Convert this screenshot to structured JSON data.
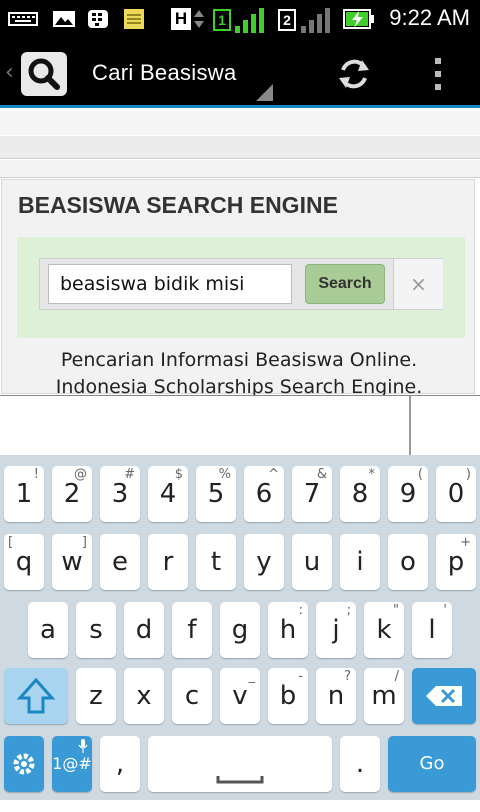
{
  "status_bar": {
    "time": "9:22 AM",
    "sim1": "1",
    "sim2": "2",
    "network_letter": "H"
  },
  "action_bar": {
    "title": "Cari Beasiswa"
  },
  "page": {
    "heading": "BEASISWA SEARCH ENGINE",
    "search_value": "beasiswa bidik misi",
    "search_button": "Search",
    "clear_symbol": "×",
    "tagline_1": "Pencarian Informasi Beasiswa Online.",
    "tagline_2": "Indonesia Scholarships Search Engine."
  },
  "keyboard": {
    "row1": [
      {
        "k": "1",
        "s": "!"
      },
      {
        "k": "2",
        "s": "@"
      },
      {
        "k": "3",
        "s": "#"
      },
      {
        "k": "4",
        "s": "$"
      },
      {
        "k": "5",
        "s": "%"
      },
      {
        "k": "6",
        "s": "^"
      },
      {
        "k": "7",
        "s": "&"
      },
      {
        "k": "8",
        "s": "*"
      },
      {
        "k": "9",
        "s": "("
      },
      {
        "k": "0",
        "s": ")"
      }
    ],
    "row2": [
      {
        "k": "q",
        "s": "["
      },
      {
        "k": "w",
        "s": "]"
      },
      {
        "k": "e",
        "s": ""
      },
      {
        "k": "r",
        "s": ""
      },
      {
        "k": "t",
        "s": ""
      },
      {
        "k": "y",
        "s": ""
      },
      {
        "k": "u",
        "s": ""
      },
      {
        "k": "i",
        "s": ""
      },
      {
        "k": "o",
        "s": ""
      },
      {
        "k": "p",
        "s": "+"
      }
    ],
    "row3": [
      {
        "k": "a",
        "s": ""
      },
      {
        "k": "s",
        "s": ""
      },
      {
        "k": "d",
        "s": ""
      },
      {
        "k": "f",
        "s": ""
      },
      {
        "k": "g",
        "s": ""
      },
      {
        "k": "h",
        "s": ":"
      },
      {
        "k": "j",
        "s": ";"
      },
      {
        "k": "k",
        "s": "\""
      },
      {
        "k": "l",
        "s": "'"
      }
    ],
    "row4": [
      {
        "k": "z",
        "s": ""
      },
      {
        "k": "x",
        "s": ""
      },
      {
        "k": "c",
        "s": ""
      },
      {
        "k": "v",
        "s": "_"
      },
      {
        "k": "b",
        "s": "-"
      },
      {
        "k": "n",
        "s": "?"
      },
      {
        "k": "m",
        "s": "/"
      }
    ],
    "symbols_label": "1@#",
    "comma": ",",
    "period": ".",
    "go_label": "Go"
  },
  "icons": {
    "back": "chevron-left-icon",
    "search": "search-icon",
    "refresh": "refresh-icon",
    "overflow": "overflow-menu-icon",
    "shift": "shift-icon",
    "backspace": "backspace-icon",
    "settings": "gear-icon",
    "mic": "microphone-icon"
  },
  "colors": {
    "accent": "#1a86c4",
    "search_button": "#a9cb95",
    "search_panel": "#dff0d8",
    "keyboard_bg": "#cfd9e1",
    "key_blue": "#3a9ad6"
  }
}
